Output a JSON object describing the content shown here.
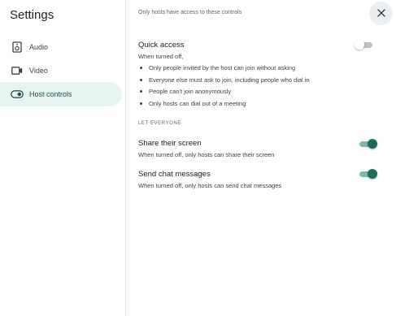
{
  "sidebar": {
    "title": "Settings",
    "items": [
      {
        "label": "Audio",
        "icon": "speaker-icon",
        "active": false
      },
      {
        "label": "Video",
        "icon": "video-camera-icon",
        "active": false
      },
      {
        "label": "Host controls",
        "icon": "toggle-icon",
        "active": true
      }
    ]
  },
  "main": {
    "notice": "Only hosts have access to these controls",
    "close_icon": "close-icon",
    "quick_access": {
      "title": "Quick access",
      "enabled": false,
      "description": "When turned off,",
      "bullets": [
        "Only people invited by the host can join without asking",
        "Everyone else must ask to join, including people who dial in",
        "People can't join anonymously",
        "Only hosts can dial out of a meeting"
      ]
    },
    "group_label": "LET EVERYONE",
    "share_screen": {
      "title": "Share their screen",
      "description": "When turned off, only hosts can share their screen",
      "enabled": true
    },
    "chat": {
      "title": "Send chat messages",
      "description": "When turned off, only hosts can send chat messages",
      "enabled": true
    }
  },
  "colors": {
    "accent": "#1e6b5c",
    "active_nav_bg": "#e6f4f1"
  }
}
